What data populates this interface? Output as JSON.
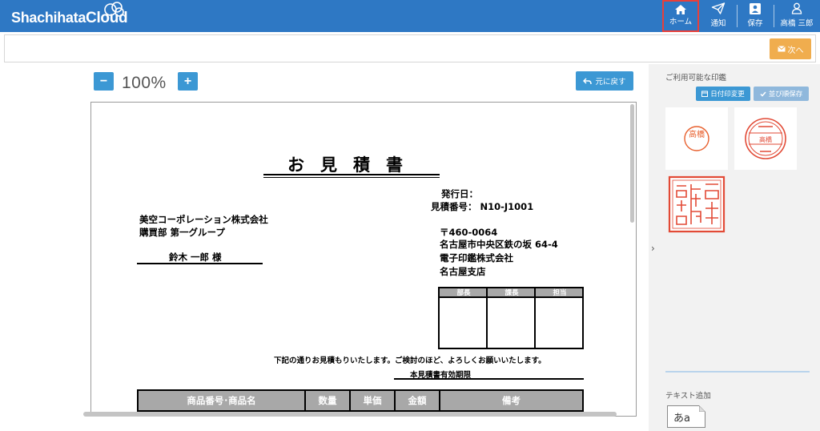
{
  "header": {
    "logo_text": "Shachihata",
    "logo_cloud": "Cloud",
    "nav": [
      {
        "label": "ホーム",
        "icon": "home-icon"
      },
      {
        "label": "通知",
        "icon": "paper-plane-icon"
      },
      {
        "label": "保存",
        "icon": "save-icon"
      },
      {
        "label": "高橋 三郎",
        "icon": "user-icon"
      }
    ]
  },
  "toolbar": {
    "next_label": "次へ"
  },
  "viewer": {
    "zoom_minus": "−",
    "zoom_plus": "+",
    "zoom_level": "100%",
    "back_label": "元に戻す"
  },
  "document": {
    "title": "お見積書",
    "issue_date_label": "発行日：",
    "quote_no": "見積番号： N10-J1001",
    "client_company": "美空コーポレーション株式会社",
    "client_dept": "購買部 第一グループ",
    "client_person": "鈴木 一郎 様",
    "postal": "〒460-0064",
    "address": "名古屋市中央区鉄の坂 64-4",
    "company": "電子印鑑株式会社",
    "branch": "名古屋支店",
    "approval_headers": [
      "部長",
      "課長",
      "担当"
    ],
    "message": "下記の通りお見積もりいたします。ご検討のほど、よろしくお願いいたします。",
    "validity": "本見積書有効期限",
    "table_headers": [
      "商品番号･商品名",
      "数量",
      "単価",
      "金額",
      "備考"
    ]
  },
  "panel": {
    "stamps_label": "ご利用可能な印鑑",
    "date_change_label": "日付印変更",
    "reorder_label": "並び順保存",
    "stamps": [
      {
        "type": "round-name",
        "text": "高橋"
      },
      {
        "type": "date-seal",
        "text": "高橋"
      },
      {
        "type": "company-seal",
        "text": ""
      }
    ],
    "text_add_label": "テキスト追加",
    "text_add_button": "あa"
  },
  "colors": {
    "header_bg": "#2e78c4",
    "accent_blue": "#3c98d4",
    "next_orange": "#f0ad4e",
    "stamp_red": "#e24a36",
    "highlight_red": "#e8403a"
  }
}
